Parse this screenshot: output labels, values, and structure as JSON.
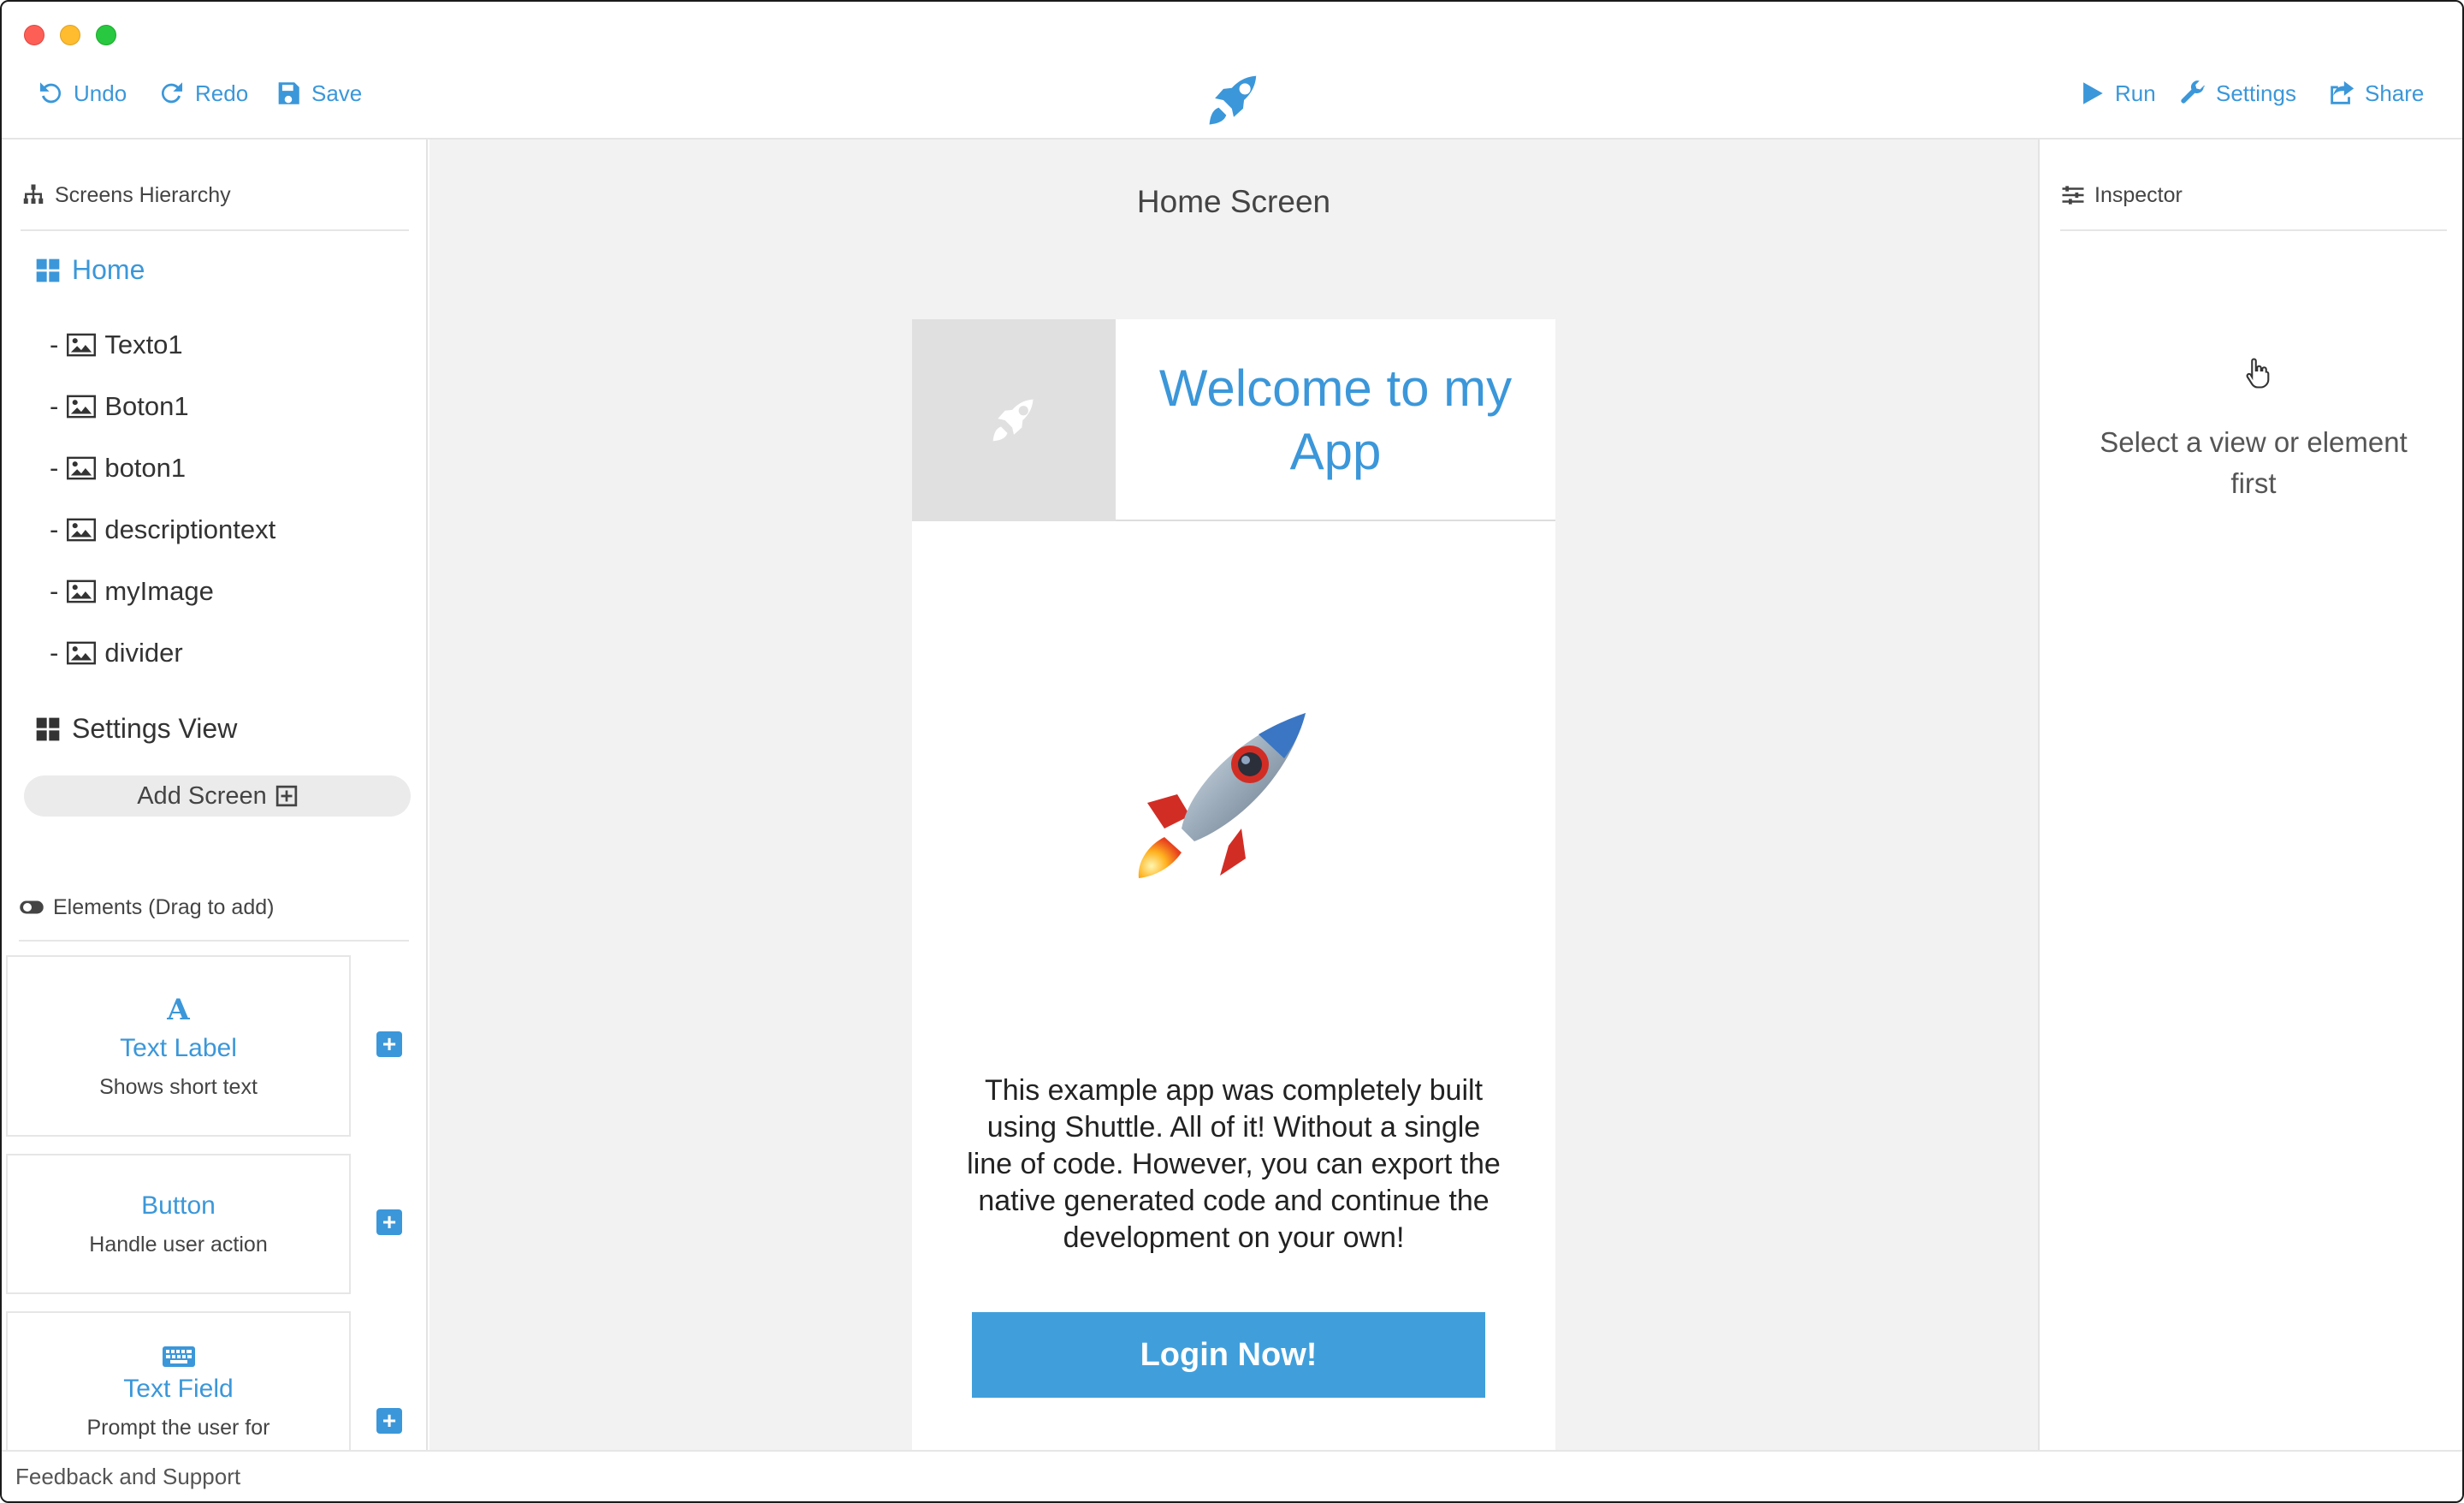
{
  "toolbar": {
    "undo_label": "Undo",
    "redo_label": "Redo",
    "save_label": "Save",
    "run_label": "Run",
    "settings_label": "Settings",
    "share_label": "Share",
    "logo_icon": "rocket-icon"
  },
  "left_sidebar": {
    "screens_title": "Screens Hierarchy",
    "screens": [
      {
        "label": "Home",
        "children": [
          {
            "prefix": "-",
            "label": "Texto1"
          },
          {
            "prefix": "-",
            "label": "Boton1"
          },
          {
            "prefix": "-",
            "label": "boton1"
          },
          {
            "prefix": "-",
            "label": "descriptiontext"
          },
          {
            "prefix": "-",
            "label": "myImage"
          },
          {
            "prefix": "-",
            "label": "divider"
          }
        ]
      },
      {
        "label": "Settings View"
      }
    ],
    "add_screen_label": "Add Screen",
    "elements_title": "Elements (Drag to add)",
    "elements": [
      {
        "icon_glyph": "A",
        "title": "Text Label",
        "desc": "Shows short text"
      },
      {
        "title": "Button",
        "desc": "Handle user action"
      },
      {
        "icon_glyph": "⌨",
        "title": "Text Field",
        "desc": "Prompt the user for"
      }
    ]
  },
  "canvas": {
    "screen_title": "Home Screen",
    "phone": {
      "welcome_text": "Welcome to my App",
      "description": "This example app was completely built using Shuttle. All of it! Without a single line of code. However, you can export the native generated code and continue the development on your own!",
      "login_button": "Login Now!"
    }
  },
  "inspector": {
    "title": "Inspector",
    "empty_message": "Select a view or element first"
  },
  "footer": {
    "link": "Feedback and Support"
  },
  "colors": {
    "accent": "#3b97d9",
    "button": "#409fdb",
    "canvas_bg": "#f2f2f2"
  }
}
